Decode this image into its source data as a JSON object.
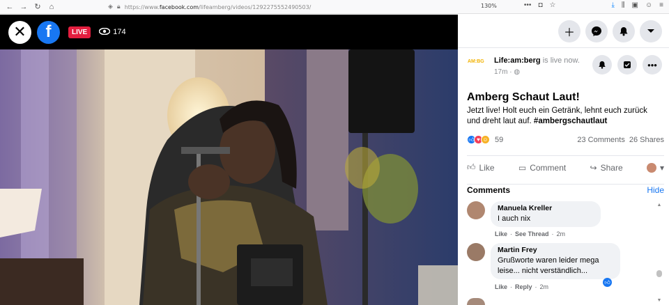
{
  "browser": {
    "url_prefix": "https://www.",
    "url_domain": "facebook.com",
    "url_path": "/lifeamberg/videos/1292275552490503/",
    "zoom": "130%",
    "more_label": "•••"
  },
  "video": {
    "live_label": "LIVE",
    "viewer_count": "174",
    "fb_logo_letter": "f"
  },
  "post": {
    "page_name": "Life:am:berg",
    "status_text": "is live now.",
    "time": "17m",
    "avatar_text": "AM:BG",
    "title": "Amberg Schaut Laut!",
    "body": "Jetzt live! Holt euch ein Getränk, lehnt euch zurück und dreht laut auf.",
    "hashtag": "#ambergschautlaut",
    "reaction_count": "59",
    "comments_count": "23 Comments",
    "shares_count": "26 Shares",
    "like_label": "Like",
    "comment_label": "Comment",
    "share_label": "Share"
  },
  "comments_section": {
    "title": "Comments",
    "hide_label": "Hide",
    "items": [
      {
        "name": "Manuela Kreller",
        "text": "I auch nix",
        "like": "Like",
        "action": "See Thread",
        "time": "2m"
      },
      {
        "name": "Martin Frey",
        "text_line1": "Grußworte waren leider mega",
        "text_line2": "leise... nicht verständlich...",
        "like": "Like",
        "action": "Reply",
        "time": "2m"
      }
    ]
  },
  "colors": {
    "facebook_blue": "#1877f2",
    "live_red": "#e41e3f",
    "bubble_gray": "#f0f2f5"
  }
}
